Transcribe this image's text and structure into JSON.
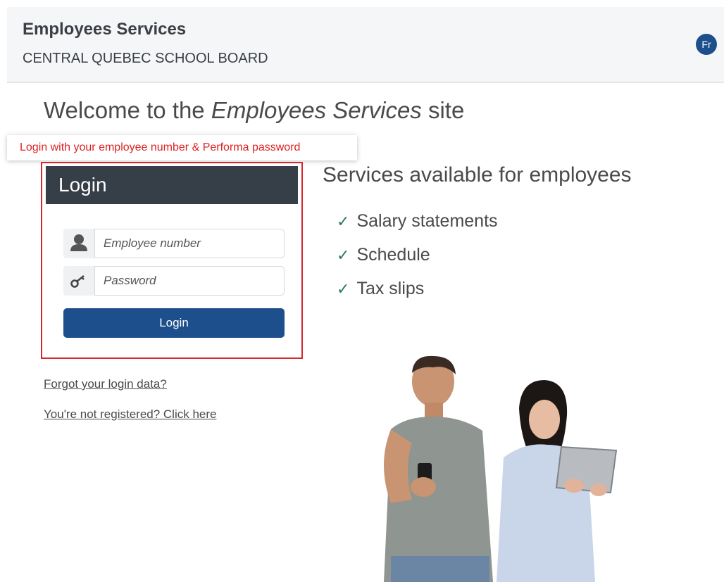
{
  "header": {
    "title": "Employees Services",
    "subtitle": "CENTRAL QUEBEC SCHOOL BOARD",
    "lang_button": "Fr"
  },
  "welcome": {
    "prefix": "Welcome to the",
    "emphasis": "Employees Services",
    "suffix": "site"
  },
  "tooltip": "Login with your employee number & Performa password",
  "login": {
    "heading": "Login",
    "employee_placeholder": "Employee number",
    "password_placeholder": "Password",
    "button_label": "Login",
    "icons": [
      "user-icon",
      "key-icon"
    ]
  },
  "links": {
    "forgot": "Forgot your login data?",
    "register": "You're not registered? Click here"
  },
  "services": {
    "title": "Services available for employees",
    "items": [
      "Salary statements",
      "Schedule",
      "Tax slips"
    ]
  },
  "colors": {
    "brand_blue": "#1d4f8c",
    "login_header": "#363e47",
    "highlight_red": "#d8262f",
    "check_green": "#2a7a5a"
  }
}
